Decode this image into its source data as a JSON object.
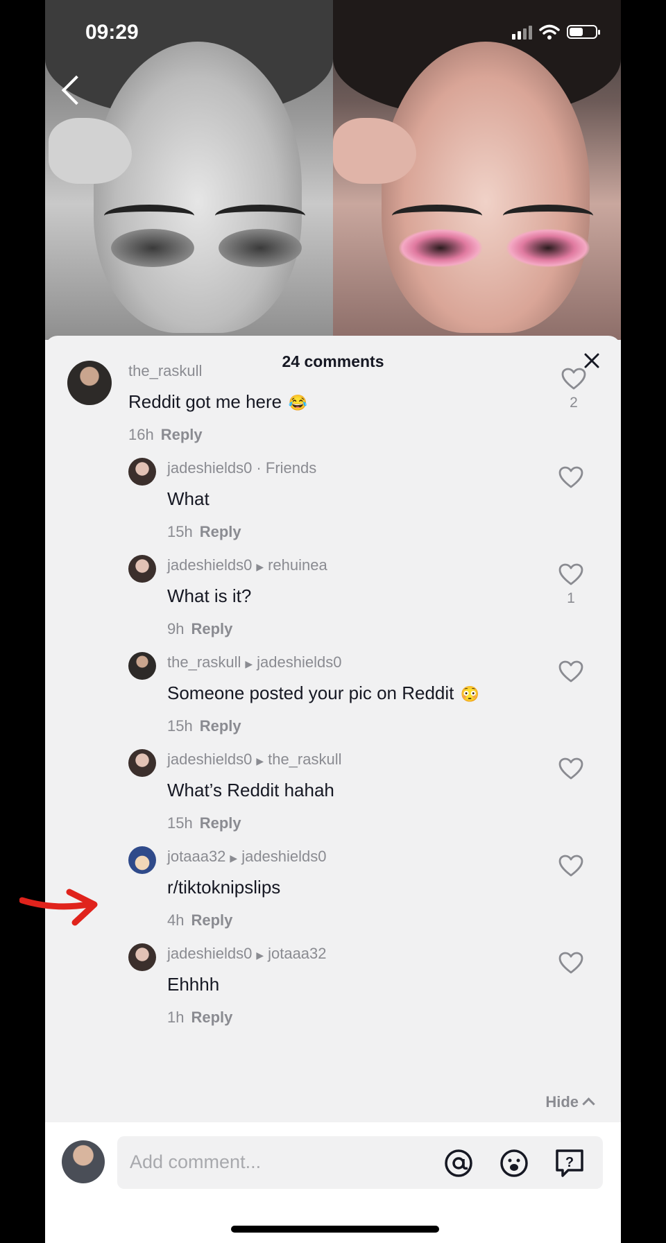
{
  "status": {
    "time": "09:29"
  },
  "sheet": {
    "title": "24 comments"
  },
  "comments": [
    {
      "user": "the_raskull",
      "to": "",
      "tag": "",
      "text": "Reddit got me here",
      "time": "16h",
      "reply": "Reply",
      "likes": "2",
      "emoji": "😂"
    },
    {
      "user": "jadeshields0",
      "to": "",
      "tag": "Friends",
      "text": "What",
      "time": "15h",
      "reply": "Reply",
      "likes": "",
      "emoji": ""
    },
    {
      "user": "jadeshields0",
      "to": "rehuinea",
      "tag": "",
      "text": "What is it?",
      "time": "9h",
      "reply": "Reply",
      "likes": "1",
      "emoji": ""
    },
    {
      "user": "the_raskull",
      "to": "jadeshields0",
      "tag": "",
      "text": "Someone posted your pic on Reddit",
      "time": "15h",
      "reply": "Reply",
      "likes": "",
      "emoji": "😳"
    },
    {
      "user": "jadeshields0",
      "to": "the_raskull",
      "tag": "",
      "text": "What’s Reddit hahah",
      "time": "15h",
      "reply": "Reply",
      "likes": "",
      "emoji": ""
    },
    {
      "user": "jotaaa32",
      "to": "jadeshields0",
      "tag": "",
      "text": "r/tiktoknipslips",
      "time": "4h",
      "reply": "Reply",
      "likes": "",
      "emoji": ""
    },
    {
      "user": "jadeshields0",
      "to": "jotaaa32",
      "tag": "",
      "text": "Ehhhh",
      "time": "1h",
      "reply": "Reply",
      "likes": "",
      "emoji": ""
    }
  ],
  "hide_label": "Hide",
  "composer": {
    "placeholder": "Add comment..."
  },
  "colors": {
    "accent_arrow": "#e0231c",
    "text_primary": "#161823",
    "text_secondary": "#8a8b91"
  }
}
